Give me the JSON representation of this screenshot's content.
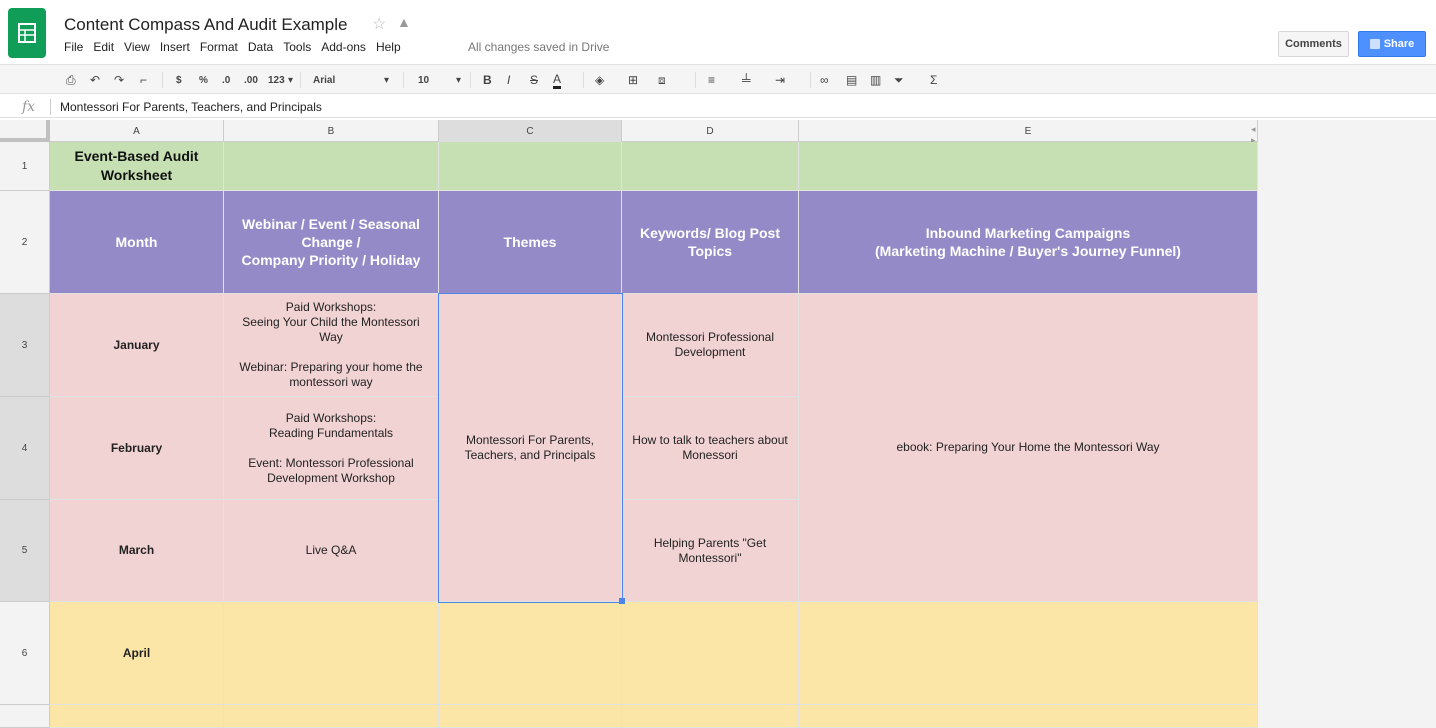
{
  "app": {
    "title": "Content Compass And Audit Example",
    "save_status": "All changes saved in Drive",
    "menu": [
      "File",
      "Edit",
      "View",
      "Insert",
      "Format",
      "Data",
      "Tools",
      "Add-ons",
      "Help"
    ],
    "comments_label": "Comments",
    "share_label": "Share",
    "brand_color": "#0f9d58",
    "share_color": "#4d90fe"
  },
  "toolbar": {
    "currency": "$",
    "percent": "%",
    "dec_less": ".0",
    "dec_more": ".00",
    "more_formats": "123",
    "font": "Arial",
    "font_size": "10",
    "bold": "B",
    "italic": "I",
    "strike": "S",
    "text_color": "A",
    "sum": "Σ"
  },
  "formula_bar": {
    "fx": "fx",
    "value": "Montessori For Parents, Teachers, and Principals"
  },
  "columns": [
    "A",
    "B",
    "C",
    "D",
    "E"
  ],
  "rows": [
    "1",
    "2",
    "3",
    "4",
    "5",
    "6"
  ],
  "cells": {
    "a1": "Event-Based Audit\nWorksheet",
    "a2": "Month",
    "b2": "Webinar / Event / Seasonal\nChange /\nCompany Priority / Holiday",
    "c2": "Themes",
    "d2": "Keywords/ Blog Post\nTopics",
    "e2": "Inbound Marketing Campaigns\n(Marketing Machine / Buyer's Journey Funnel)",
    "a3": "January",
    "b3": "Paid Workshops:\nSeeing Your Child the Montessori\nWay\n\nWebinar: Preparing your home the\nmontessori way",
    "c3to5": "Montessori For Parents,\nTeachers, and Principals",
    "d3": "Montessori Professional\nDevelopment",
    "e3to5": "ebook: Preparing Your Home the Montessori Way",
    "a4": "February",
    "b4": "Paid Workshops:\nReading Fundamentals\n\nEvent: Montessori Professional\nDevelopment Workshop",
    "d4": "How to talk to teachers about\nMonessori",
    "a5": "March",
    "b5": "Live Q&A",
    "d5": "Helping Parents \"Get\nMontessori\"",
    "a6": "April"
  },
  "colors": {
    "title_row": "#c6dfb3",
    "header_row": "#958ac8",
    "q1_rows": "#f2d3d3",
    "q2_rows": "#fbe6a7",
    "selection": "#4a86e8"
  }
}
